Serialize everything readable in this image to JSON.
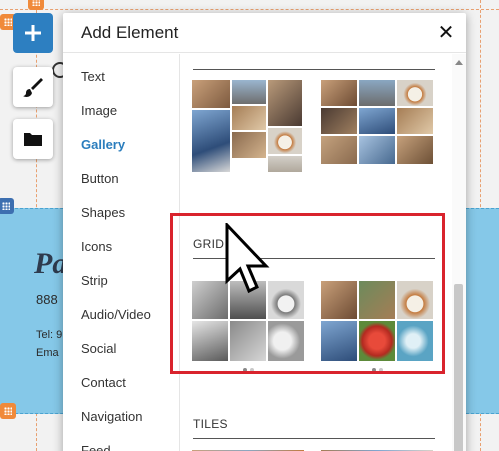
{
  "panel": {
    "title": "Add Element",
    "close_icon": "close-icon"
  },
  "toolbar": {
    "add_icon": "plus-icon",
    "design_icon": "paintbrush-icon",
    "pages_icon": "folder-icon"
  },
  "categories": [
    {
      "label": "Text",
      "active": false
    },
    {
      "label": "Image",
      "active": false
    },
    {
      "label": "Gallery",
      "active": true
    },
    {
      "label": "Button",
      "active": false
    },
    {
      "label": "Shapes",
      "active": false
    },
    {
      "label": "Icons",
      "active": false
    },
    {
      "label": "Strip",
      "active": false
    },
    {
      "label": "Audio/Video",
      "active": false
    },
    {
      "label": "Social",
      "active": false
    },
    {
      "label": "Contact",
      "active": false
    },
    {
      "label": "Navigation",
      "active": false
    },
    {
      "label": "Feed",
      "active": false
    }
  ],
  "sections": {
    "grid": "GRID",
    "tiles": "TILES"
  },
  "background": {
    "heading_fragment": "Pa",
    "phone_fragment": "888",
    "tel_fragment": "Tel: 9",
    "email_fragment": "Ema"
  },
  "colors": {
    "accent": "#2a7dbd",
    "highlight": "#d9232d",
    "strip": "#85c8e8"
  }
}
